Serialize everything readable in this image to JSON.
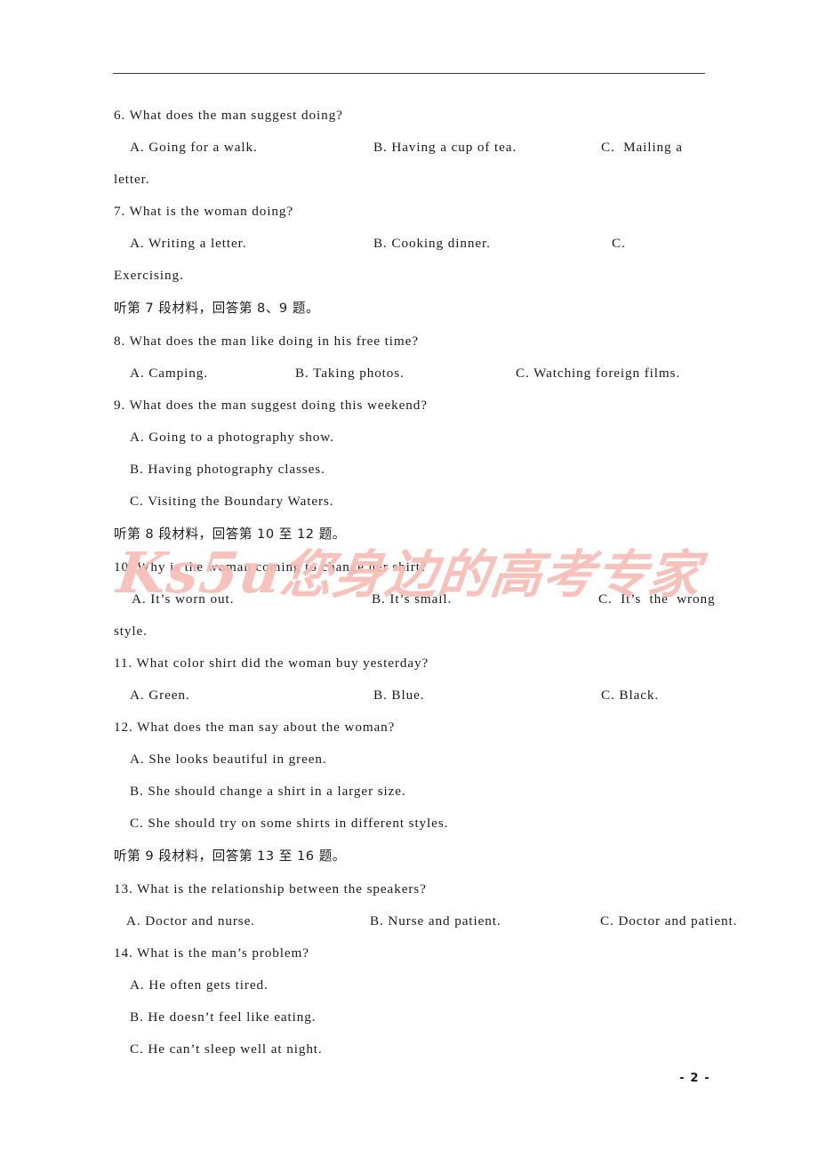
{
  "document": {
    "page_number_label": "- 2 -",
    "watermark": {
      "latin": "Ks5u",
      "chinese": "您身边的高考专家",
      "color": "#f7bdb6"
    }
  },
  "questions": [
    {
      "number": "6.",
      "stem": "6. What does the man suggest doing?",
      "options_row": {
        "a": "A. Going for a walk.",
        "b": "B. Having a cup of tea.",
        "c": "C.  Mailing a"
      },
      "continuation": "letter."
    },
    {
      "number": "7.",
      "stem": "7. What is the woman doing?",
      "options_row": {
        "a": "A. Writing a letter.",
        "b": "B. Cooking dinner.",
        "c": "C."
      },
      "continuation": "Exercising."
    }
  ],
  "section_headings": {
    "material_7": "听第 7 段材料，回答第 8、9 题。",
    "material_8": "听第 8 段材料，回答第 10 至 12 题。",
    "material_9": "听第 9 段材料，回答第 13 至 16 题。"
  },
  "q8": {
    "stem": "8. What does the man like doing in his free time?",
    "a": "A. Camping.",
    "b": "B. Taking photos.",
    "c": "C. Watching foreign films."
  },
  "q9": {
    "stem": "9. What does the man suggest doing this weekend?",
    "a": "A. Going to a photography show.",
    "b": "B. Having photography classes.",
    "c": "C. Visiting the Boundary Waters."
  },
  "q10": {
    "stem": "10. Why is the woman coming to change her shirt?",
    "a": "A. It’s worn out.",
    "b": "B. It’s small.",
    "c": "C.  It’s  the  wrong",
    "continuation": "style."
  },
  "q11": {
    "stem": "11. What color shirt did the woman buy yesterday?",
    "a": "A. Green.",
    "b": "B. Blue.",
    "c": "C. Black."
  },
  "q12": {
    "stem": "12. What does the man say about the woman?",
    "a": "A. She looks beautiful in green.",
    "b": "B. She should change a shirt in a larger size.",
    "c": "C. She should try on some shirts in different styles."
  },
  "q13": {
    "stem": "13. What is the relationship between the speakers?",
    "a": "A. Doctor and nurse.",
    "b": "B. Nurse and patient.",
    "c": "C. Doctor and patient."
  },
  "q14": {
    "stem": "14. What is the man’s problem?",
    "a": "A. He often gets tired.",
    "b": "B. He doesn’t feel like eating.",
    "c": "C. He can’t sleep well at night."
  }
}
